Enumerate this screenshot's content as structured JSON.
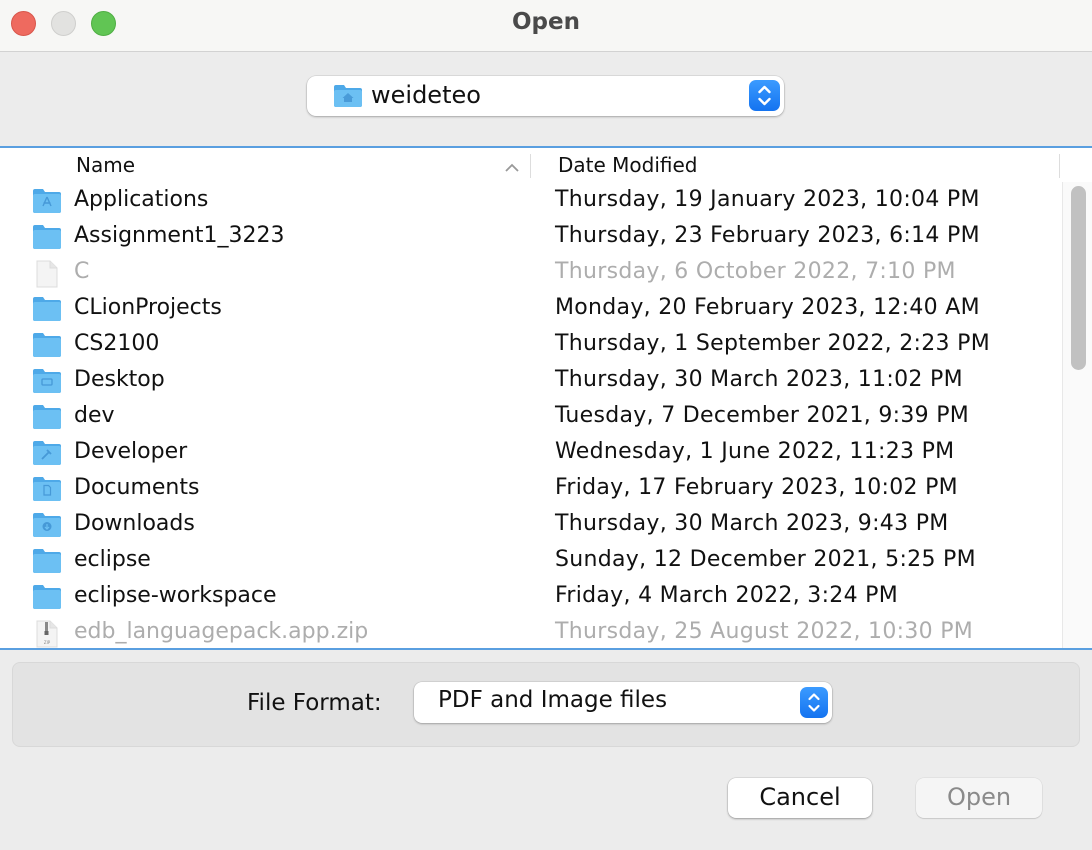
{
  "window": {
    "title": "Open",
    "controls": [
      "close",
      "minimize",
      "maximize"
    ]
  },
  "location": {
    "current": "weideteo",
    "icon": "home-folder-icon"
  },
  "columns": {
    "name": "Name",
    "date_modified": "Date Modified",
    "sort": "ascending"
  },
  "files": [
    {
      "name": "Applications",
      "date": "Thursday, 19 January 2023, 10:04 PM",
      "icon": "applications-folder-icon",
      "enabled": true
    },
    {
      "name": "Assignment1_3223",
      "date": "Thursday, 23 February 2023, 6:14 PM",
      "icon": "folder-icon",
      "enabled": true
    },
    {
      "name": "C",
      "date": "Thursday, 6 October 2022, 7:10 PM",
      "icon": "file-icon",
      "enabled": false
    },
    {
      "name": "CLionProjects",
      "date": "Monday, 20 February 2023, 12:40 AM",
      "icon": "folder-icon",
      "enabled": true
    },
    {
      "name": "CS2100",
      "date": "Thursday, 1 September 2022, 2:23 PM",
      "icon": "folder-icon",
      "enabled": true
    },
    {
      "name": "Desktop",
      "date": "Thursday, 30 March 2023, 11:02 PM",
      "icon": "desktop-folder-icon",
      "enabled": true
    },
    {
      "name": "dev",
      "date": "Tuesday, 7 December 2021, 9:39 PM",
      "icon": "folder-icon",
      "enabled": true
    },
    {
      "name": "Developer",
      "date": "Wednesday, 1 June 2022, 11:23 PM",
      "icon": "developer-folder-icon",
      "enabled": true
    },
    {
      "name": "Documents",
      "date": "Friday, 17 February 2023, 10:02 PM",
      "icon": "documents-folder-icon",
      "enabled": true
    },
    {
      "name": "Downloads",
      "date": "Thursday, 30 March 2023, 9:43 PM",
      "icon": "downloads-folder-icon",
      "enabled": true
    },
    {
      "name": "eclipse",
      "date": "Sunday, 12 December 2021, 5:25 PM",
      "icon": "folder-icon",
      "enabled": true
    },
    {
      "name": "eclipse-workspace",
      "date": "Friday, 4 March 2022, 3:24 PM",
      "icon": "folder-icon",
      "enabled": true
    },
    {
      "name": "edb_languagepack.app.zip",
      "date": "Thursday, 25 August 2022, 10:30 PM",
      "icon": "zip-file-icon",
      "enabled": false
    }
  ],
  "format": {
    "label": "File Format:",
    "selected": "PDF and Image files"
  },
  "buttons": {
    "cancel": "Cancel",
    "open": "Open"
  },
  "colors": {
    "accent": "#1473f0",
    "focus_border": "#5a9fe0",
    "folder": "#5ab4ef",
    "disabled_text": "#adadad"
  }
}
